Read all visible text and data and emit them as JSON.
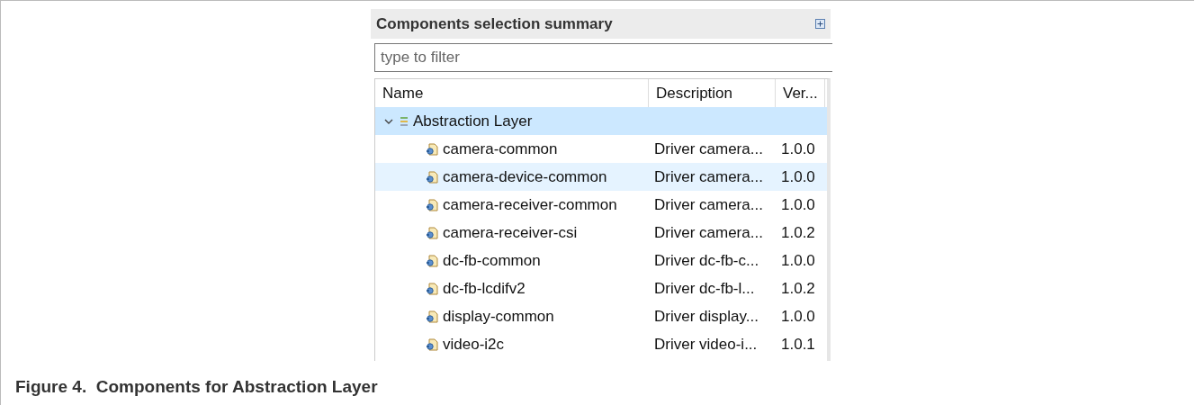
{
  "panel": {
    "title": "Components selection summary"
  },
  "filter": {
    "placeholder": "type to filter"
  },
  "table": {
    "columns": [
      "Name",
      "Description",
      "Ver..."
    ],
    "rows": [
      {
        "name": "Abstraction Layer",
        "kind": "group",
        "expanded": true,
        "selected": true,
        "children": [
          {
            "name": "camera-common",
            "kind": "component",
            "description": "Driver camera...",
            "version": "1.0.0",
            "selected": false,
            "hovered": false
          },
          {
            "name": "camera-device-common",
            "kind": "component",
            "description": "Driver camera...",
            "version": "1.0.0",
            "selected": false,
            "hovered": true
          },
          {
            "name": "camera-receiver-common",
            "kind": "component",
            "description": "Driver camera...",
            "version": "1.0.0",
            "selected": false,
            "hovered": false
          },
          {
            "name": "camera-receiver-csi",
            "kind": "component",
            "description": "Driver camera...",
            "version": "1.0.2",
            "selected": false,
            "hovered": false
          },
          {
            "name": "dc-fb-common",
            "kind": "component",
            "description": "Driver dc-fb-c...",
            "version": "1.0.0",
            "selected": false,
            "hovered": false
          },
          {
            "name": "dc-fb-lcdifv2",
            "kind": "component",
            "description": "Driver dc-fb-l...",
            "version": "1.0.2",
            "selected": false,
            "hovered": false
          },
          {
            "name": "display-common",
            "kind": "component",
            "description": "Driver display...",
            "version": "1.0.0",
            "selected": false,
            "hovered": false
          },
          {
            "name": "video-i2c",
            "kind": "component",
            "description": "Driver video-i...",
            "version": "1.0.1",
            "selected": false,
            "hovered": false
          }
        ]
      }
    ]
  },
  "caption": "Figure 4.  Components for Abstraction Layer"
}
